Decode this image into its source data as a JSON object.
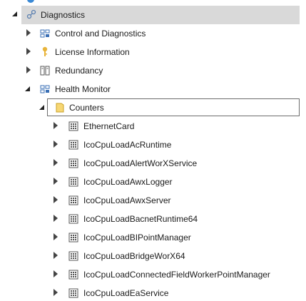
{
  "tree": {
    "diagnostics": {
      "label": "Diagnostics",
      "children": [
        {
          "label": "Control and Diagnostics",
          "icon": "component-icon"
        },
        {
          "label": "License Information",
          "icon": "key-icon"
        },
        {
          "label": "Redundancy",
          "icon": "redundancy-icon"
        },
        {
          "label": "Health Monitor",
          "icon": "component-icon"
        }
      ]
    },
    "counters": {
      "label": "Counters",
      "items": [
        "EthernetCard",
        "IcoCpuLoadAcRuntime",
        "IcoCpuLoadAlertWorXService",
        "IcoCpuLoadAwxLogger",
        "IcoCpuLoadAwxServer",
        "IcoCpuLoadBacnetRuntime64",
        "IcoCpuLoadBIPointManager",
        "IcoCpuLoadBridgeWorX64",
        "IcoCpuLoadConnectedFieldWorkerPointManager",
        "IcoCpuLoadEaService"
      ]
    }
  },
  "colors": {
    "selection": "#d9d9d9",
    "accent": "#3b8ad6",
    "folder": "#f2c94c"
  }
}
